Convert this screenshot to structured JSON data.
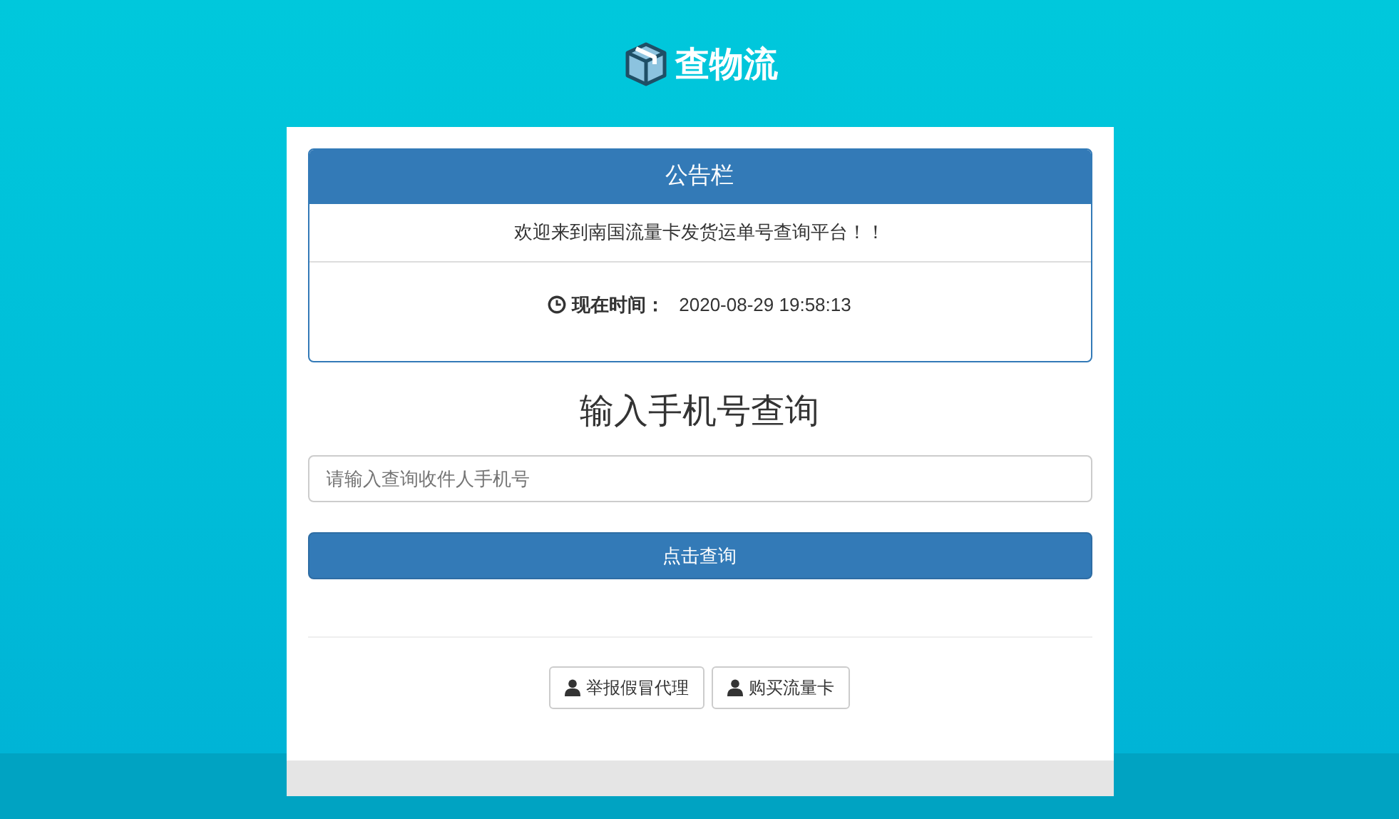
{
  "logo": {
    "text": "查物流"
  },
  "notice": {
    "title": "公告栏",
    "message": "欢迎来到南国流量卡发货运单号查询平台！！",
    "time_label": "现在时间：",
    "time_value": "2020-08-29 19:58:13"
  },
  "query": {
    "heading": "输入手机号查询",
    "placeholder": "请输入查询收件人手机号",
    "submit": "点击查询"
  },
  "links": [
    {
      "label": "举报假冒代理"
    },
    {
      "label": "购买流量卡"
    }
  ]
}
